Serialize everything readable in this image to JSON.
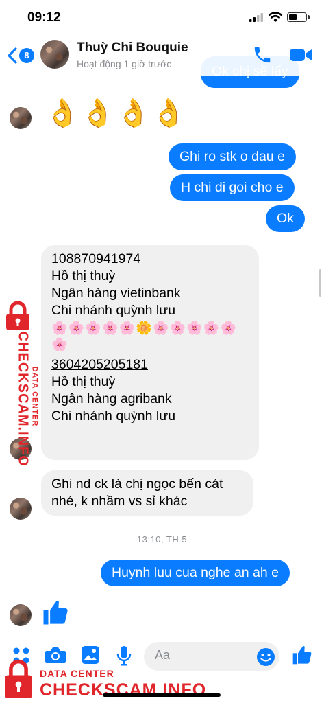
{
  "status_bar": {
    "time": "09:12"
  },
  "header": {
    "back_count": "8",
    "contact_name": "Thuỳ Chi Bouquie",
    "active_status": "Hoạt động 1 giờ trước"
  },
  "messages": {
    "partial_top": "Ok chị sẽ lấy",
    "emoji_okay": "👌👌👌👌",
    "out1": "Ghi ro stk o dau e",
    "out2": "H chi di goi cho e",
    "out3": "Ok",
    "bank1_number": "108870941974",
    "bank1_name": "Hồ thị thuỳ",
    "bank1_bank": "Ngân hàng vietinbank",
    "bank1_branch": "Chi nhánh quỳnh lưu",
    "flowers": "🌸🌸🌸🌸🌸🌼🌸🌸🌸🌸🌸🌸",
    "bank2_number": "3604205205181",
    "bank2_name": "Hồ thị thuỳ",
    "bank2_bank": "Ngân hàng agribank",
    "bank2_branch": "Chi nhánh quỳnh lưu",
    "note_line1": "Ghi nd ck là chị ngọc bến cát",
    "note_line2": "nhé, k nhầm vs sỉ khác",
    "timestamp": "13:10, TH 5",
    "out4": "Huynh luu cua nghe an ah e"
  },
  "composer": {
    "placeholder": "Aa"
  },
  "watermark": {
    "side_top": "DATA CENTER",
    "side_main": "CHECKSCAM.INFO",
    "bottom_top": "DATA CENTER",
    "bottom_main": "CHECKSCAM.INFO"
  },
  "colors": {
    "accent": "#0a7cff",
    "incoming_bg": "#f0f0f0",
    "watermark": "#e0262b"
  },
  "icons": [
    "phone-icon",
    "video-icon",
    "menu-dots-icon",
    "camera-icon",
    "gallery-icon",
    "mic-icon",
    "smile-icon",
    "thumbs-up-icon",
    "lock-icon"
  ]
}
